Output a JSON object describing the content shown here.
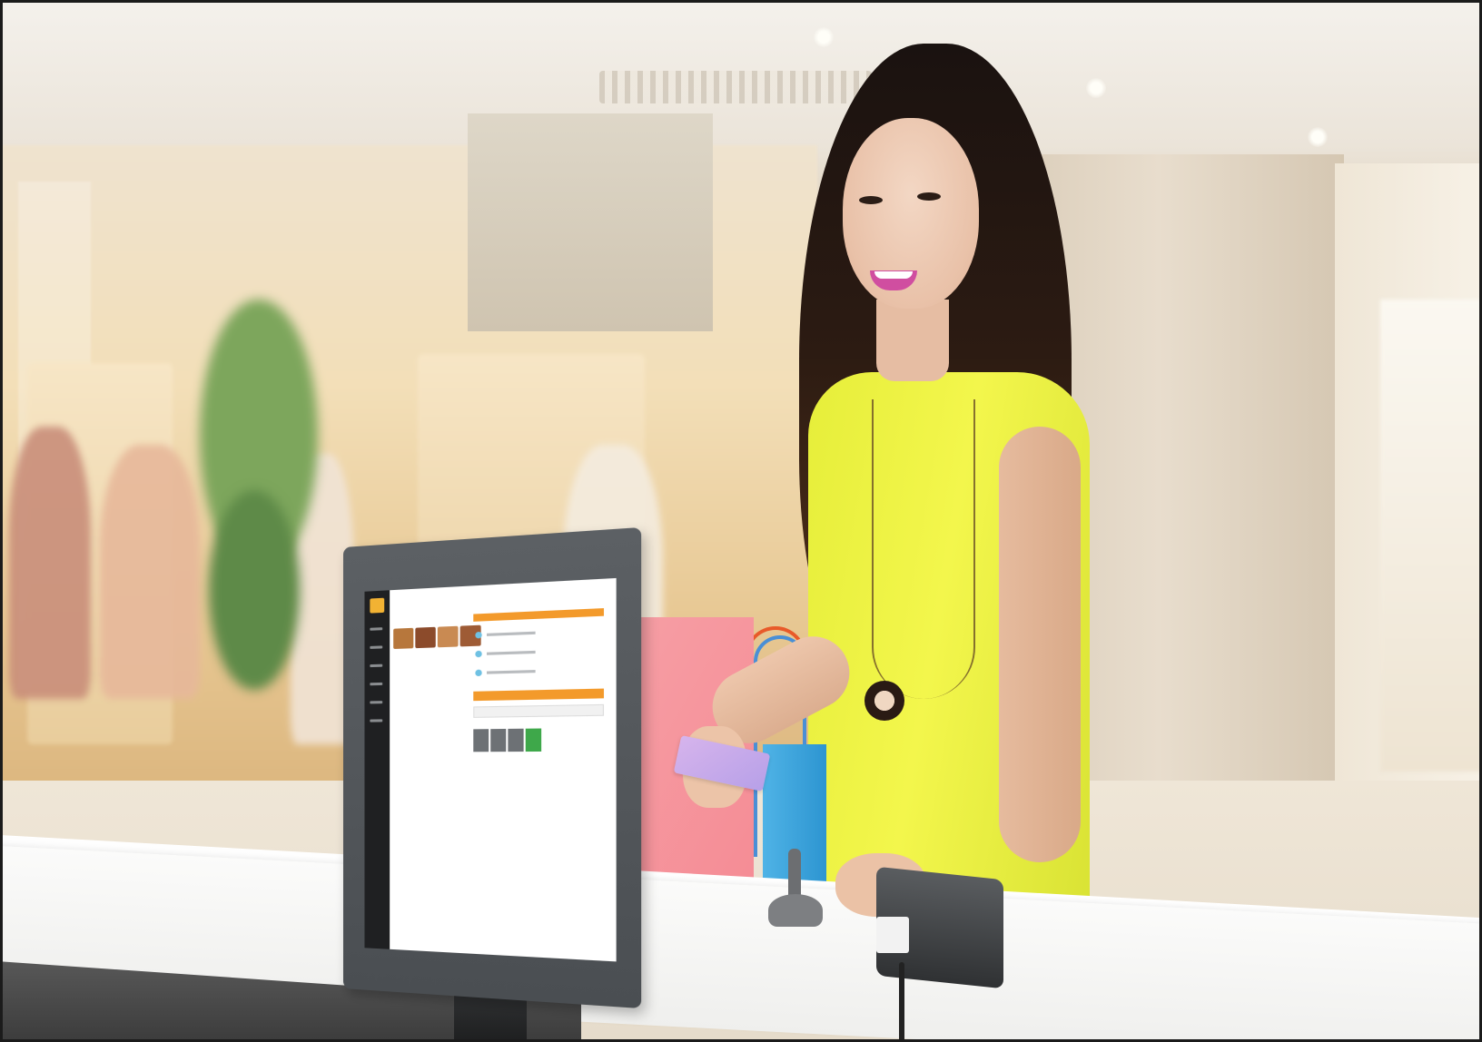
{
  "scene": {
    "subject": "woman",
    "setting": "shopping-mall",
    "objects": [
      "pos-monitor",
      "card-terminal",
      "credit-card",
      "shopping-bags",
      "stylus-holder",
      "counter"
    ]
  },
  "colors": {
    "dress": "#eef243",
    "hair": "#2c1b12",
    "bag_pink": "#f58c95",
    "bag_blue": "#2d95d1",
    "monitor": "#4e5256",
    "pos_accent": "#f39a2b",
    "pos_confirm": "#3ea84a",
    "card": "#c8a8ea",
    "background": "#ead9bc"
  },
  "pos_screen": {
    "product_thumbnails": 4,
    "cart_items": 3,
    "keypad_keys": 4
  }
}
